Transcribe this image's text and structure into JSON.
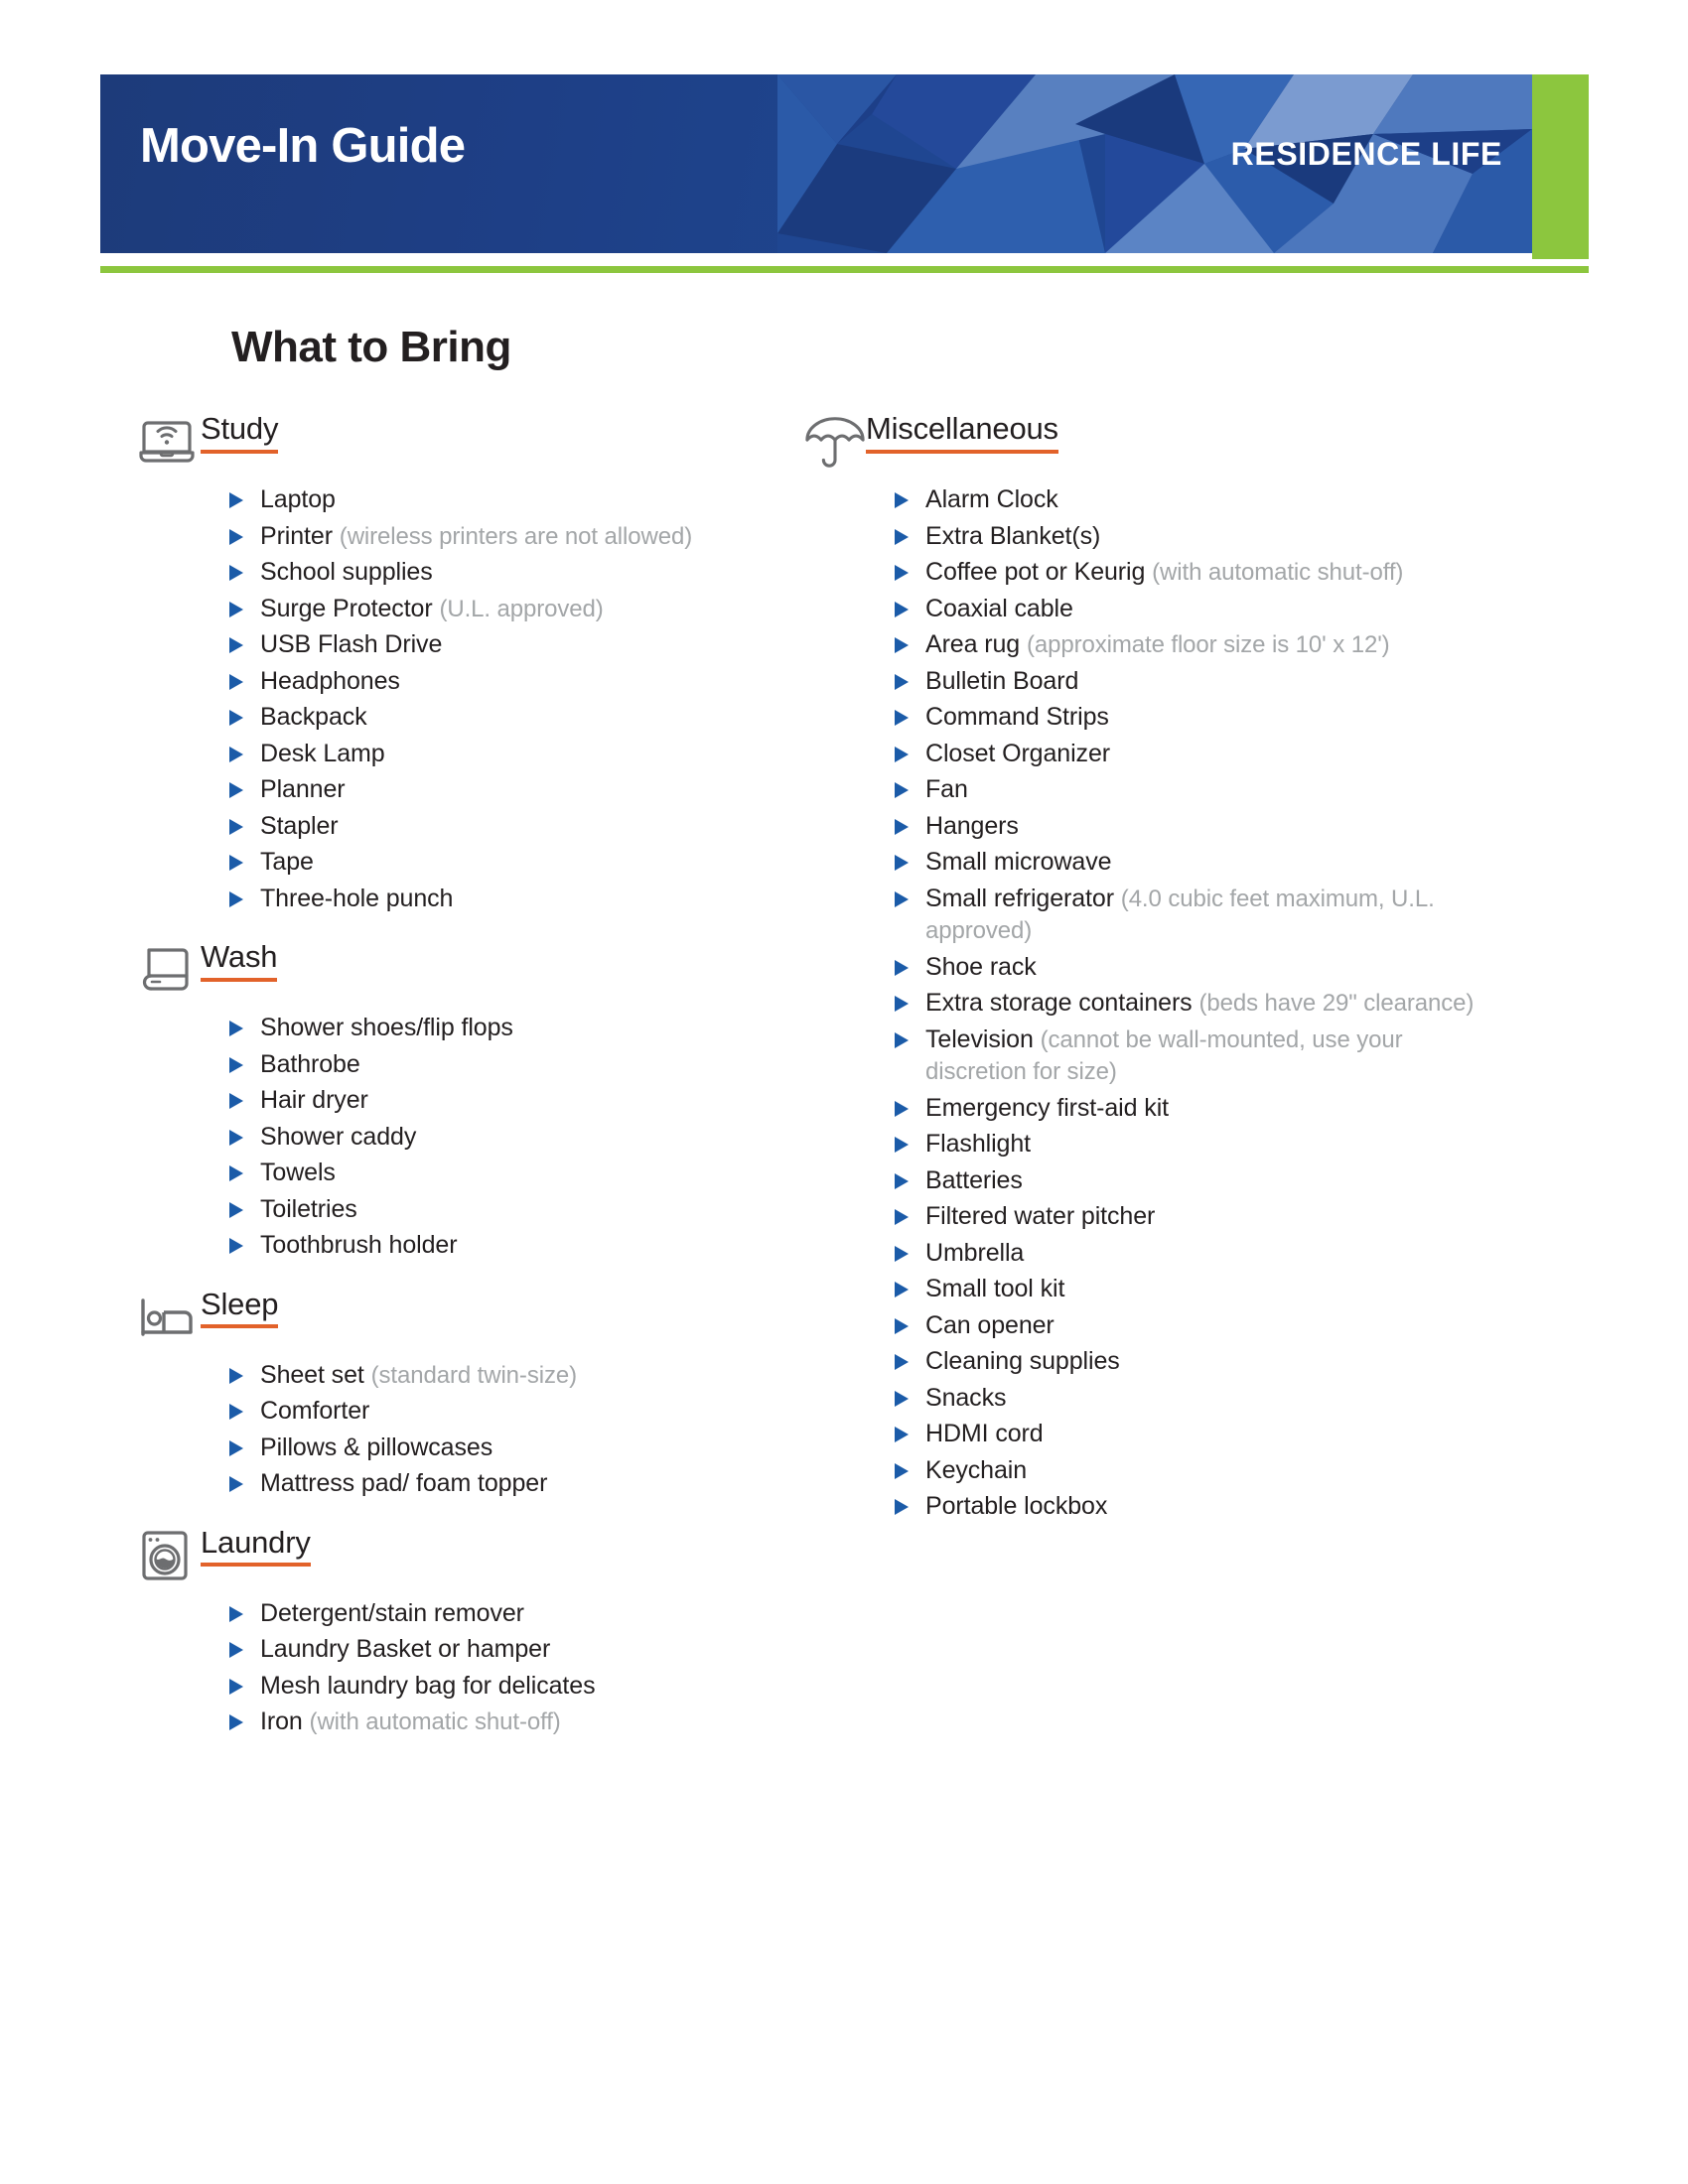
{
  "header": {
    "title": "Move-In Guide",
    "subtitle": "RESIDENCE LIFE",
    "accent_green": "#8cc63e",
    "banner_blue": "#1e3f86"
  },
  "page_title": "What to Bring",
  "accents": {
    "underline_orange": "#e2622a",
    "bullet_blue": "#1b5ba8",
    "note_gray": "#a3a6a8",
    "icon_gray": "#6d6e70"
  },
  "sections": [
    {
      "title": "Study",
      "icon": "laptop-wifi-icon",
      "column": "left",
      "items": [
        {
          "text": "Laptop",
          "note": ""
        },
        {
          "text": "Printer",
          "note": "(wireless printers are not allowed)"
        },
        {
          "text": "School supplies",
          "note": ""
        },
        {
          "text": "Surge Protector",
          "note": "(U.L. approved)"
        },
        {
          "text": "USB Flash Drive",
          "note": ""
        },
        {
          "text": "Headphones",
          "note": ""
        },
        {
          "text": "Backpack",
          "note": ""
        },
        {
          "text": "Desk Lamp",
          "note": ""
        },
        {
          "text": "Planner",
          "note": ""
        },
        {
          "text": "Stapler",
          "note": ""
        },
        {
          "text": "Tape",
          "note": ""
        },
        {
          "text": "Three-hole punch",
          "note": ""
        }
      ]
    },
    {
      "title": "Wash",
      "icon": "folded-towel-icon",
      "column": "left",
      "items": [
        {
          "text": "Shower shoes/flip flops",
          "note": ""
        },
        {
          "text": "Bathrobe",
          "note": ""
        },
        {
          "text": "Hair dryer",
          "note": ""
        },
        {
          "text": "Shower caddy",
          "note": ""
        },
        {
          "text": "Towels",
          "note": ""
        },
        {
          "text": "Toiletries",
          "note": ""
        },
        {
          "text": "Toothbrush holder",
          "note": ""
        }
      ]
    },
    {
      "title": "Sleep",
      "icon": "bed-icon",
      "column": "left",
      "items": [
        {
          "text": "Sheet set",
          "note": "(standard twin-size)"
        },
        {
          "text": "Comforter",
          "note": ""
        },
        {
          "text": "Pillows & pillowcases",
          "note": ""
        },
        {
          "text": "Mattress pad/ foam topper",
          "note": ""
        }
      ]
    },
    {
      "title": "Laundry",
      "icon": "washing-machine-icon",
      "column": "left",
      "items": [
        {
          "text": "Detergent/stain remover",
          "note": ""
        },
        {
          "text": "Laundry Basket or hamper",
          "note": ""
        },
        {
          "text": "Mesh laundry bag for delicates",
          "note": ""
        },
        {
          "text": "Iron",
          "note": "(with automatic shut-off)"
        }
      ]
    },
    {
      "title": "Miscellaneous",
      "icon": "umbrella-icon",
      "column": "right",
      "items": [
        {
          "text": "Alarm Clock",
          "note": ""
        },
        {
          "text": "Extra Blanket(s)",
          "note": ""
        },
        {
          "text": "Coffee pot or Keurig",
          "note": "(with automatic shut-off)"
        },
        {
          "text": "Coaxial cable",
          "note": ""
        },
        {
          "text": "Area rug",
          "note": "(approximate floor size is 10' x 12')"
        },
        {
          "text": "Bulletin Board",
          "note": ""
        },
        {
          "text": "Command Strips",
          "note": ""
        },
        {
          "text": "Closet Organizer",
          "note": ""
        },
        {
          "text": "Fan",
          "note": ""
        },
        {
          "text": "Hangers",
          "note": ""
        },
        {
          "text": "Small microwave",
          "note": ""
        },
        {
          "text": "Small refrigerator",
          "note": "(4.0 cubic feet maximum, U.L. approved)"
        },
        {
          "text": "Shoe rack",
          "note": ""
        },
        {
          "text": "Extra storage containers",
          "note": "(beds have 29\" clearance)"
        },
        {
          "text": "Television",
          "note": "(cannot be wall-mounted, use your discretion for size)"
        },
        {
          "text": "Emergency first-aid kit",
          "note": ""
        },
        {
          "text": "Flashlight",
          "note": ""
        },
        {
          "text": "Batteries",
          "note": ""
        },
        {
          "text": "Filtered water pitcher",
          "note": ""
        },
        {
          "text": "Umbrella",
          "note": ""
        },
        {
          "text": "Small tool kit",
          "note": ""
        },
        {
          "text": "Can opener",
          "note": ""
        },
        {
          "text": "Cleaning supplies",
          "note": ""
        },
        {
          "text": "Snacks",
          "note": ""
        },
        {
          "text": "HDMI cord",
          "note": ""
        },
        {
          "text": "Keychain",
          "note": ""
        },
        {
          "text": "Portable lockbox",
          "note": ""
        }
      ]
    }
  ]
}
